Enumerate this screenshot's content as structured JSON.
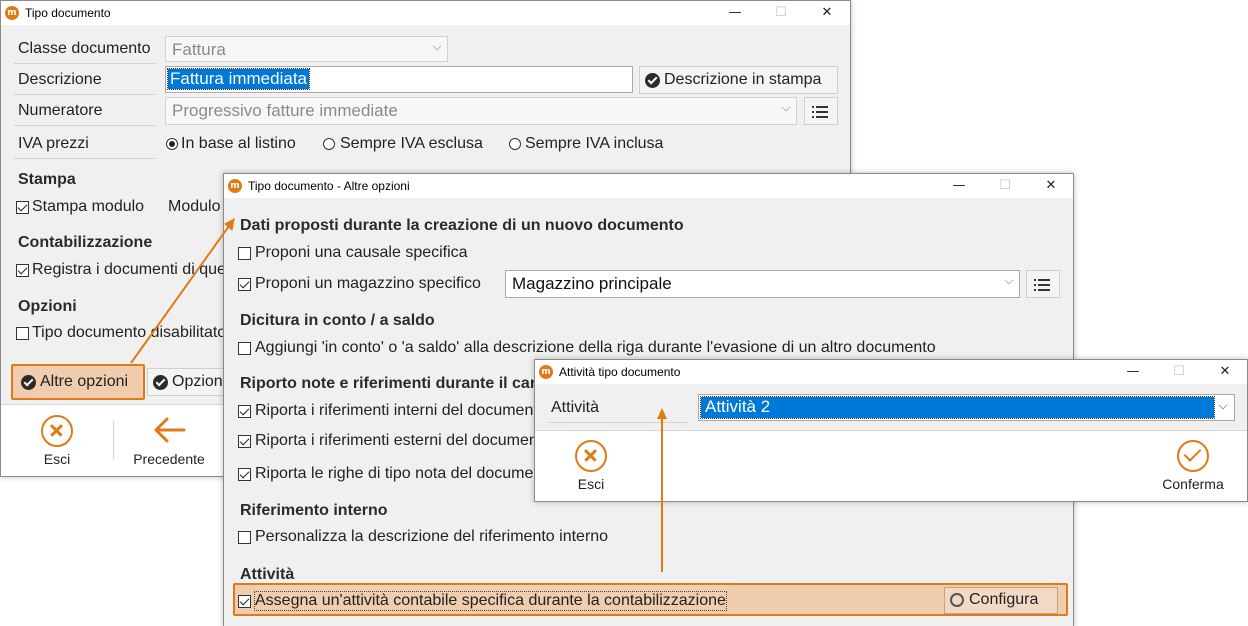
{
  "win1": {
    "title": "Tipo documento",
    "fields": {
      "classe_label": "Classe documento",
      "classe_value": "Fattura",
      "descrizione_label": "Descrizione",
      "descrizione_value": "Fattura immediata",
      "descrizione_btn": "Descrizione in stampa",
      "numeratore_label": "Numeratore",
      "numeratore_value": "Progressivo fatture immediate",
      "iva_label": "IVA prezzi",
      "iva_options": [
        "In base al listino",
        "Sempre IVA esclusa",
        "Sempre IVA inclusa"
      ],
      "iva_selected": "In base al listino"
    },
    "stampa": {
      "title": "Stampa",
      "stampa_modulo": "Stampa modulo",
      "modulo_label": "Modulo"
    },
    "contabilizzazione": {
      "title": "Contabilizzazione",
      "registra": "Registra i documenti di ques"
    },
    "opzioni": {
      "title": "Opzioni",
      "disabilitato": "Tipo documento disabilitato"
    },
    "buttons": {
      "altre_opzioni": "Altre opzioni",
      "opzioni": "Opzioni"
    },
    "footer": {
      "esci": "Esci",
      "precedente": "Precedente"
    }
  },
  "win2": {
    "title": "Tipo documento - Altre opzioni",
    "dati": {
      "title": "Dati proposti durante la creazione di un nuovo documento",
      "causale": "Proponi una causale specifica",
      "magazzino": "Proponi un magazzino specifico",
      "magazzino_value": "Magazzino principale"
    },
    "dicitura": {
      "title": "Dicitura in conto / a saldo",
      "aggiungi": "Aggiungi 'in conto' o 'a saldo' alla descrizione della riga durante l'evasione di un altro documento"
    },
    "riporto": {
      "title": "Riporto note e riferimenti durante il cari",
      "interni": "Riporta i riferimenti interni del documento",
      "esterni": "Riporta i riferimenti esterni del document",
      "righe": "Riporta le righe di tipo nota del documen"
    },
    "riferimento": {
      "title": "Riferimento interno",
      "personalizza": "Personalizza la descrizione del riferimento interno"
    },
    "attivita": {
      "title": "Attività",
      "assegna": "Assegna un'attività contabile specifica durante la contabilizzazione",
      "configura": "Configura"
    }
  },
  "win3": {
    "title": "Attività tipo documento",
    "attivita_label": "Attività",
    "attivita_value": "Attività 2",
    "footer": {
      "esci": "Esci",
      "conferma": "Conferma"
    }
  },
  "colors": {
    "accent": "#e07a16",
    "selection": "#0078d7",
    "highlight": "#f0b078"
  }
}
